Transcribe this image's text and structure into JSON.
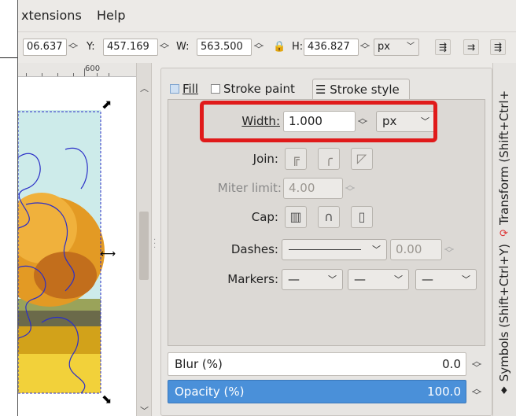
{
  "menu": {
    "extensions": "xtensions",
    "help": "Help"
  },
  "toolbar": {
    "x_value": "06.637",
    "y_label": "Y:",
    "y_value": "457.169",
    "w_label": "W:",
    "w_value": "563.500",
    "h_label": "H:",
    "h_value": "436.827",
    "unit": "px"
  },
  "ruler": {
    "label": "600"
  },
  "tabs": {
    "fill": "Fill",
    "stroke_paint": "Stroke paint",
    "stroke_style": "Stroke style"
  },
  "stroke": {
    "width_label": "Width:",
    "width_value": "1.000",
    "width_unit": "px",
    "join_label": "Join:",
    "miter_label": "Miter limit:",
    "miter_value": "4.00",
    "cap_label": "Cap:",
    "dashes_label": "Dashes:",
    "dashes_value": "0.00",
    "markers_label": "Markers:"
  },
  "blur": {
    "label": "Blur (%)",
    "value": "0.0"
  },
  "opacity": {
    "label": "Opacity (%)",
    "value": "100.0"
  },
  "side_tabs": {
    "transform": "Transform (Shift+Ctrl+",
    "symbols": "Symbols (Shift+Ctrl+Y)"
  },
  "colors": {
    "highlight": "#e01a1a",
    "selection": "#4a90d9"
  }
}
